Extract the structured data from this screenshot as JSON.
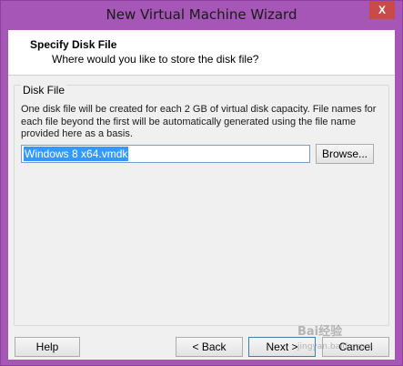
{
  "window": {
    "title": "New Virtual Machine Wizard",
    "close_glyph": "X"
  },
  "header": {
    "title": "Specify Disk File",
    "subtitle": "Where would you like to store the disk file?"
  },
  "disk_file": {
    "group_label": "Disk File",
    "description": "One disk file will be created for each 2 GB of virtual disk capacity. File names for each file beyond the first will be automatically generated using the file name provided here as a basis.",
    "file_name": "Windows 8 x64.vmdk",
    "browse_label": "Browse..."
  },
  "footer": {
    "help_label": "Help",
    "back_label": "< Back",
    "next_label": "Next >",
    "cancel_label": "Cancel"
  },
  "watermark": {
    "text": "Bai经验",
    "sub": "jingyan.baidu.com"
  }
}
